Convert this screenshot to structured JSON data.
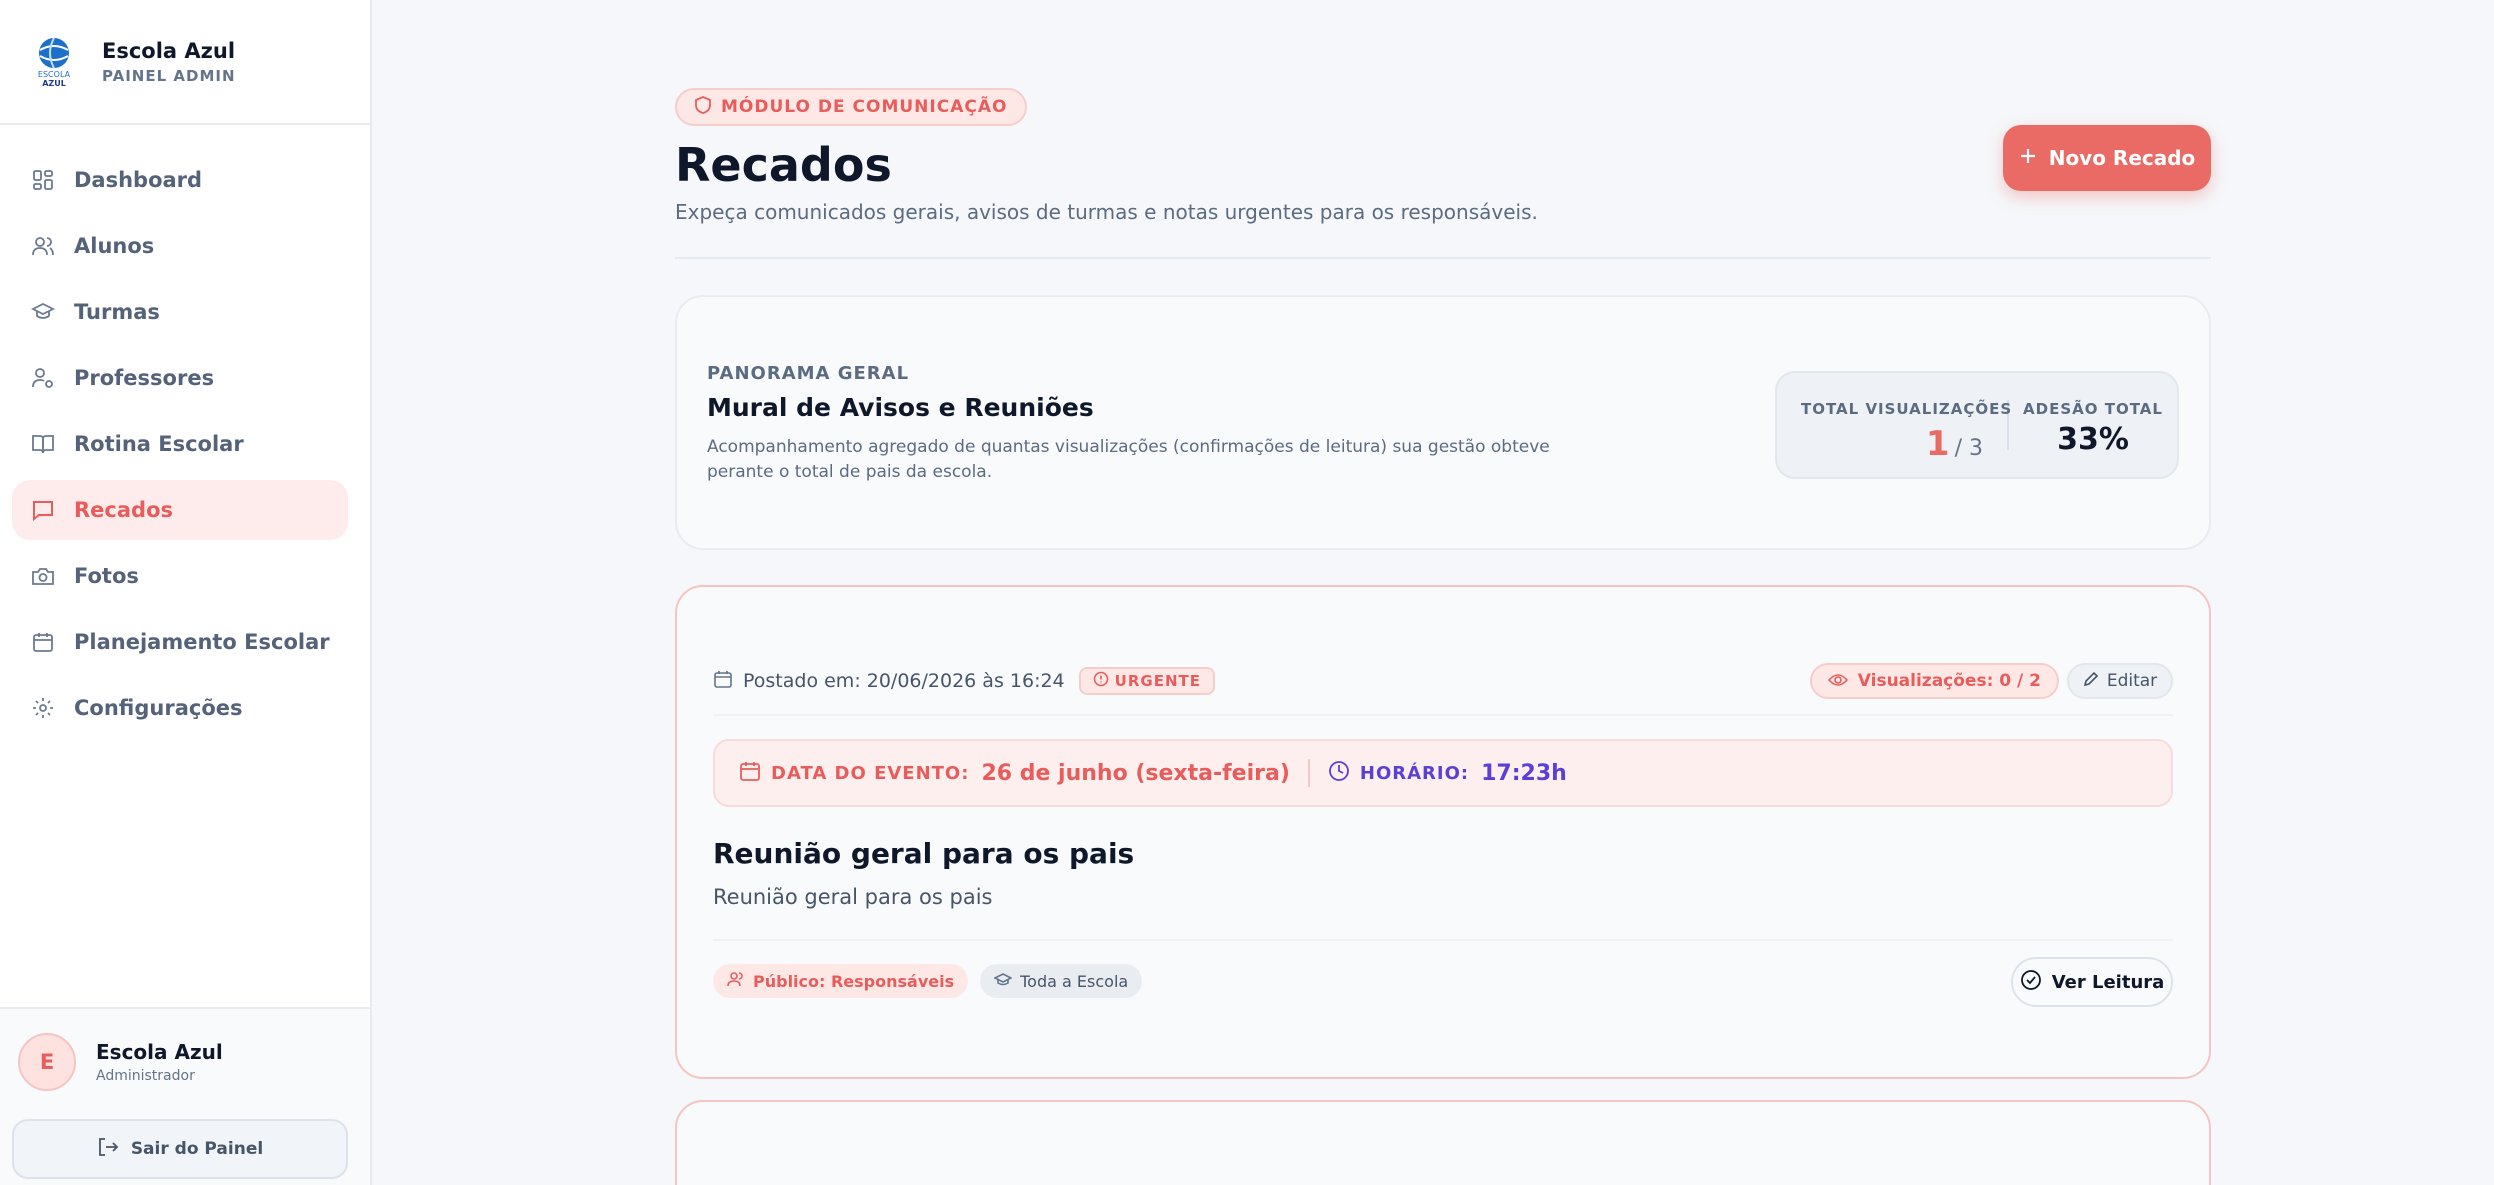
{
  "brand": {
    "name": "Escola Azul",
    "subtitle": "PAINEL ADMIN",
    "logo_text_top": "ESCOLA",
    "logo_text_bottom": "AZUL"
  },
  "nav": {
    "items": [
      {
        "label": "Dashboard",
        "icon": "grid-icon"
      },
      {
        "label": "Alunos",
        "icon": "users-icon"
      },
      {
        "label": "Turmas",
        "icon": "graduation-cap-icon"
      },
      {
        "label": "Professores",
        "icon": "user-cog-icon"
      },
      {
        "label": "Rotina Escolar",
        "icon": "book-icon"
      },
      {
        "label": "Recados",
        "icon": "message-icon",
        "active": true
      },
      {
        "label": "Fotos",
        "icon": "camera-icon"
      },
      {
        "label": "Planejamento Escolar",
        "icon": "calendar-icon"
      },
      {
        "label": "Configurações",
        "icon": "gear-icon"
      }
    ]
  },
  "user": {
    "initial": "E",
    "name": "Escola Azul",
    "role": "Administrador",
    "logout_label": "Sair do Painel"
  },
  "header": {
    "module_badge": "MÓDULO DE COMUNICAÇÃO",
    "title": "Recados",
    "subtitle": "Expeça comunicados gerais, avisos de turmas e notas urgentes para os responsáveis.",
    "new_button": "Novo Recado"
  },
  "overview": {
    "overline": "PANORAMA GERAL",
    "title": "Mural de Avisos e Reuniões",
    "description": "Acompanhamento agregado de quantas visualizações (confirmações de leitura) sua gestão obteve perante o total de pais da escola.",
    "views_label": "TOTAL VISUALIZAÇÕES",
    "views_value": "1",
    "views_total": "/ 3",
    "adhesion_label": "ADESÃO TOTAL",
    "adhesion_value": "33%"
  },
  "recado": {
    "posted": "Postado em: 20/06/2026 às 16:24",
    "urgent_label": "URGENTE",
    "views": "Visualizações: 0 / 2",
    "edit_label": "Editar",
    "event_date_label": "DATA DO EVENTO:",
    "event_date": "26 de junho (sexta-feira)",
    "event_time_label": "HORÁRIO:",
    "event_time": "17:23h",
    "title": "Reunião geral para os pais",
    "body": "Reunião geral para os pais",
    "audience": "Público: Responsáveis",
    "scope": "Toda a Escola",
    "read_label": "Ver Leitura"
  },
  "colors": {
    "accent": "#ea6a65",
    "accent_text": "#e85d5b",
    "purple": "#5b3fd6",
    "sidebar_bg": "#ffffff",
    "page_bg": "#f5f7fa"
  }
}
